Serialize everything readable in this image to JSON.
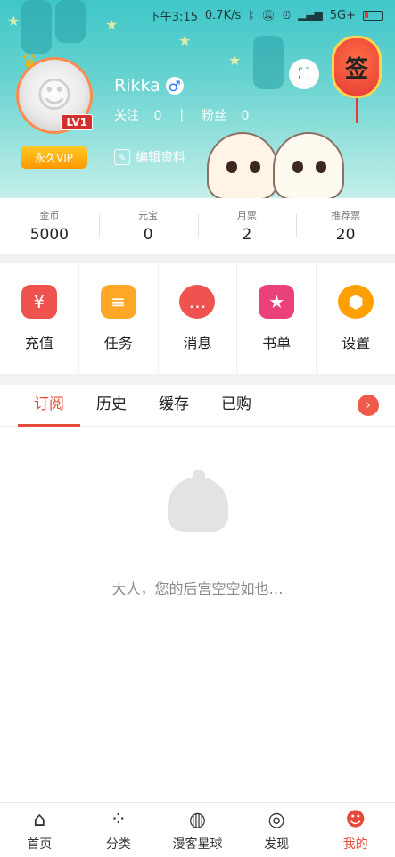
{
  "status_bar": {
    "time": "下午3:15",
    "speed": "0.7K/s",
    "network": "5G+"
  },
  "profile": {
    "username": "Rikka",
    "gender_icon": "male-icon",
    "level": "LV1",
    "vip_label": "永久VIP",
    "follow_label": "关注",
    "follow_count": "0",
    "fans_label": "粉丝",
    "fans_count": "0",
    "edit_label": "编辑资料",
    "signin_label": "签"
  },
  "stats": [
    {
      "label": "金币",
      "value": "5000"
    },
    {
      "label": "元宝",
      "value": "0"
    },
    {
      "label": "月票",
      "value": "2"
    },
    {
      "label": "推荐票",
      "value": "20"
    }
  ],
  "actions": [
    {
      "label": "充值",
      "icon": "piggy-bank-icon",
      "color": "#ef5350",
      "glyph": "¥"
    },
    {
      "label": "任务",
      "icon": "clipboard-icon",
      "color": "#ffa726",
      "glyph": "≡"
    },
    {
      "label": "消息",
      "icon": "chat-bubble-icon",
      "color": "#ef5350",
      "glyph": "…"
    },
    {
      "label": "书单",
      "icon": "book-icon",
      "color": "#ec407a",
      "glyph": "★"
    },
    {
      "label": "设置",
      "icon": "gear-icon",
      "color": "#ffa000",
      "glyph": "⬢"
    }
  ],
  "tabs": [
    {
      "label": "订阅",
      "active": true
    },
    {
      "label": "历史",
      "active": false
    },
    {
      "label": "缓存",
      "active": false
    },
    {
      "label": "已购",
      "active": false
    }
  ],
  "empty_state": {
    "message": "大人，您的后宫空空如也…"
  },
  "bottom_nav": [
    {
      "label": "首页",
      "icon": "home-icon",
      "glyph": "⌂",
      "active": false
    },
    {
      "label": "分类",
      "icon": "grid-icon",
      "glyph": "⁘",
      "active": false
    },
    {
      "label": "漫客星球",
      "icon": "planet-icon",
      "glyph": "◍",
      "active": false
    },
    {
      "label": "发现",
      "icon": "compass-icon",
      "glyph": "◎",
      "active": false
    },
    {
      "label": "我的",
      "icon": "mascot-icon",
      "glyph": "☻",
      "active": true
    }
  ],
  "colors": {
    "accent": "#e64a3b",
    "header_top": "#3fc6c8",
    "vip": "#ff9800"
  }
}
